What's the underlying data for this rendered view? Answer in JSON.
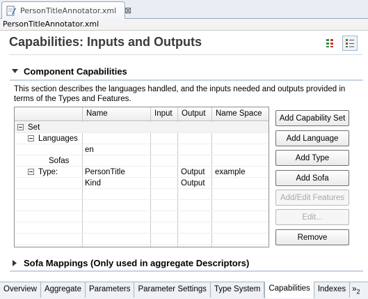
{
  "editor_tab": {
    "title": "PersonTitleAnnotator.xml",
    "close_glyph": "⊠"
  },
  "breadcrumb": "PersonTitleAnnotator.xml",
  "form": {
    "title": "Capabilities: Inputs and Outputs"
  },
  "header_tools": [
    {
      "icon": "grid-layout-icon"
    },
    {
      "icon": "list-layout-icon"
    }
  ],
  "component_capabilities": {
    "title": "Component Capabilities",
    "description": "This section describes the languages handled, and the inputs needed and outputs provided in terms of the Types and Features.",
    "columns": [
      "",
      "Name",
      "Input",
      "Output",
      "Name Space"
    ],
    "rows": [
      {
        "tree": "Set",
        "toggle": true,
        "indent": 0,
        "name": "",
        "input": "",
        "output": "",
        "namespace": ""
      },
      {
        "tree": "Languages",
        "toggle": true,
        "indent": 1,
        "name": "",
        "input": "",
        "output": "",
        "namespace": ""
      },
      {
        "tree": "",
        "toggle": false,
        "indent": 0,
        "name": "en",
        "input": "",
        "output": "",
        "namespace": ""
      },
      {
        "tree": "Sofas",
        "toggle": false,
        "indent": 2,
        "name": "",
        "input": "",
        "output": "",
        "namespace": ""
      },
      {
        "tree": "Type:",
        "toggle": true,
        "indent": 1,
        "name": "PersonTitle",
        "input": "",
        "output": "Output",
        "namespace": "example"
      },
      {
        "tree": "",
        "toggle": false,
        "indent": 0,
        "name": "Kind",
        "input": "",
        "output": "Output",
        "namespace": ""
      }
    ],
    "buttons": [
      {
        "label": "Add Capability Set",
        "enabled": true
      },
      {
        "label": "Add Language",
        "enabled": true
      },
      {
        "label": "Add Type",
        "enabled": true
      },
      {
        "label": "Add Sofa",
        "enabled": true
      },
      {
        "label": "Add/Edit Features",
        "enabled": false
      },
      {
        "label": "Edit...",
        "enabled": false
      },
      {
        "label": "Remove",
        "enabled": true
      }
    ]
  },
  "sofa_mappings": {
    "title": "Sofa Mappings (Only used in aggregate Descriptors)"
  },
  "page_tabs": [
    {
      "label": "Overview",
      "active": false
    },
    {
      "label": "Aggregate",
      "active": false
    },
    {
      "label": "Parameters",
      "active": false
    },
    {
      "label": "Parameter Settings",
      "active": false
    },
    {
      "label": "Type System",
      "active": false
    },
    {
      "label": "Capabilities",
      "active": true
    },
    {
      "label": "Indexes",
      "active": false
    }
  ],
  "more_tabs": {
    "glyph": "»",
    "count": "2"
  },
  "colors": {
    "title_text": "#3a3a3a",
    "accent_border": "#9aa8b8"
  }
}
